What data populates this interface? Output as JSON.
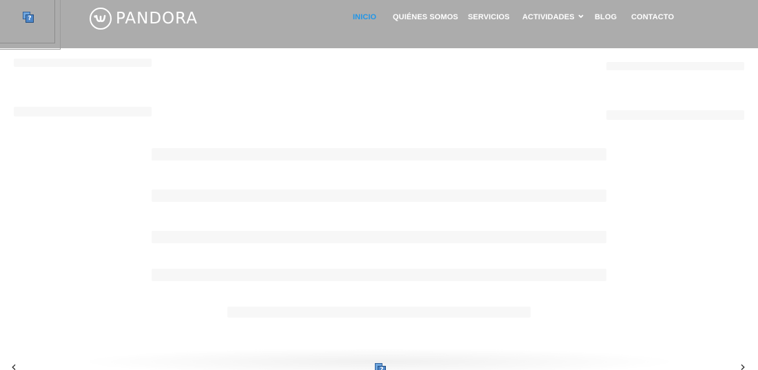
{
  "header": {
    "logo_text": "PANDORA",
    "background_color": "#acacac",
    "accent_color": "#2196e8"
  },
  "nav": {
    "items": [
      {
        "label": "INICIO",
        "active": true
      },
      {
        "label": "QUIÉNES SOMOS",
        "active": false
      },
      {
        "label": "SERVICIOS",
        "active": false
      },
      {
        "label": "ACTIVIDADES",
        "active": false,
        "has_dropdown": true
      },
      {
        "label": "BLOG",
        "active": false
      },
      {
        "label": "CONTACTO",
        "active": false
      }
    ]
  },
  "icons": {
    "broken_image": "broken-image-icon",
    "dropdown": "chevron-down-icon",
    "prev": "chevron-left-icon",
    "next": "chevron-right-icon"
  },
  "broken_image_glyph": "?",
  "carousel": {
    "prev_glyph": "‹",
    "next_glyph": "›"
  }
}
